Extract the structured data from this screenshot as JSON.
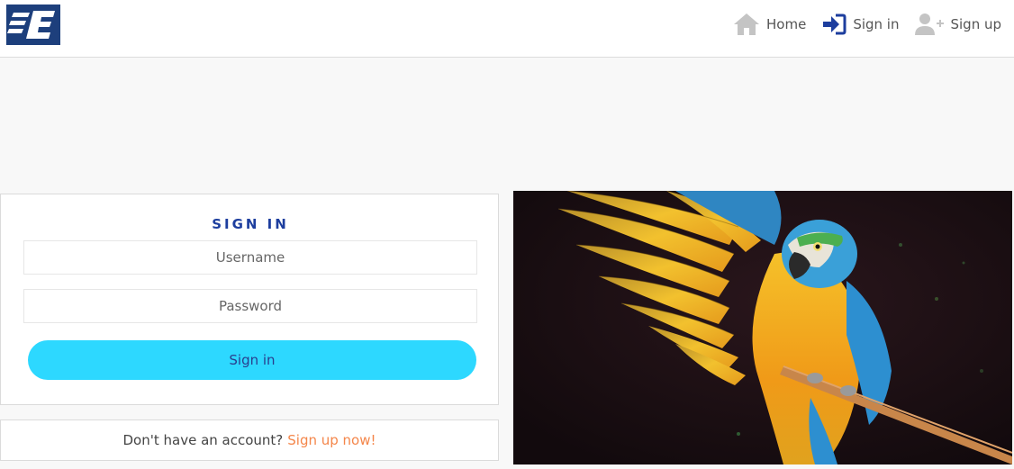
{
  "nav": {
    "home_label": "Home",
    "signin_label": "Sign in",
    "signup_label": "Sign up"
  },
  "signin": {
    "title": "SIGN IN",
    "username_placeholder": "Username",
    "password_placeholder": "Password",
    "button_label": "Sign in"
  },
  "signup": {
    "prompt": "Don't have an account?",
    "link_label": "Sign up now!"
  },
  "icons": {
    "home": "home-icon",
    "signin": "sign-in-icon",
    "signup": "user-plus-icon"
  },
  "colors": {
    "brand_navy": "#1d3f7c",
    "title_blue": "#1d3e9e",
    "button_cyan": "#2dd8ff",
    "link_orange": "#f4864a"
  }
}
